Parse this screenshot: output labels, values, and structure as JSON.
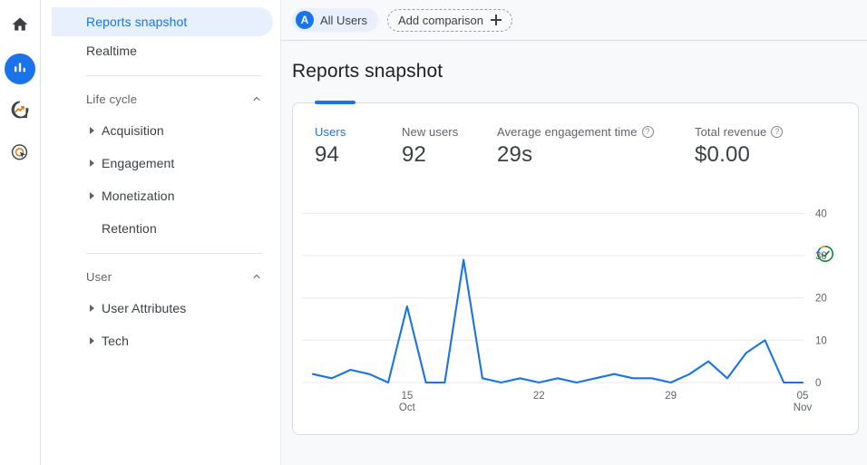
{
  "rail": {
    "items": [
      {
        "name": "home-icon",
        "label": "Home",
        "active": false
      },
      {
        "name": "reports-icon",
        "label": "Reports",
        "active": true
      },
      {
        "name": "explore-icon",
        "label": "Explore",
        "active": false
      },
      {
        "name": "advertising-icon",
        "label": "Advertising",
        "active": false
      }
    ]
  },
  "sidebar": {
    "top_items": [
      {
        "label": "Reports snapshot",
        "selected": true
      },
      {
        "label": "Realtime",
        "selected": false
      }
    ],
    "groups": [
      {
        "title": "Life cycle",
        "expanded": true,
        "items": [
          {
            "label": "Acquisition",
            "expandable": true
          },
          {
            "label": "Engagement",
            "expandable": true
          },
          {
            "label": "Monetization",
            "expandable": true
          },
          {
            "label": "Retention",
            "expandable": false
          }
        ]
      },
      {
        "title": "User",
        "expanded": true,
        "items": [
          {
            "label": "User Attributes",
            "expandable": true
          },
          {
            "label": "Tech",
            "expandable": true
          }
        ]
      }
    ]
  },
  "comparison_bar": {
    "all_users_chip": {
      "avatar_letter": "A",
      "label": "All Users"
    },
    "add_comparison": {
      "label": "Add comparison",
      "icon": "plus-icon"
    }
  },
  "page": {
    "title": "Reports snapshot"
  },
  "card": {
    "metrics": [
      {
        "label": "Users",
        "value": "94",
        "selected": true,
        "help": false
      },
      {
        "label": "New users",
        "value": "92",
        "selected": false,
        "help": false
      },
      {
        "label": "Average engagement time",
        "value": "29s",
        "selected": false,
        "help": true
      },
      {
        "label": "Total revenue",
        "value": "$0.00",
        "selected": false,
        "help": true
      }
    ],
    "insight_badge": {
      "icon": "check-circle-icon",
      "label": "Insights"
    }
  },
  "colors": {
    "accent_blue": "#1a73e8",
    "line_blue": "#1a73e8",
    "chip_bg": "#e8f0fe",
    "text_primary": "#202124",
    "text_secondary": "#5f6368",
    "grid": "#e8eaed",
    "card_border": "#dadce0",
    "page_bg": "#f8f9fa",
    "badge_green": "#188038",
    "badge_yellow": "#f9ab00",
    "badge_blue": "#1a73e8"
  },
  "chart_data": {
    "type": "line",
    "title": "",
    "xlabel": "",
    "ylabel": "",
    "ylim": [
      0,
      42
    ],
    "yticks": [
      0,
      10,
      20,
      30,
      40
    ],
    "ytick_labels": [
      "0",
      "10",
      "20",
      "30",
      "40"
    ],
    "grid": true,
    "legend": null,
    "xtick_labels": [
      {
        "primary": "15",
        "secondary": "Oct",
        "index": 5
      },
      {
        "primary": "22",
        "secondary": "",
        "index": 12
      },
      {
        "primary": "29",
        "secondary": "",
        "index": 19
      },
      {
        "primary": "05",
        "secondary": "Nov",
        "index": 26
      }
    ],
    "series": [
      {
        "name": "Users",
        "color": "#1a73e8",
        "values": [
          2,
          1,
          3,
          2,
          0,
          18,
          0,
          0,
          29,
          1,
          0,
          1,
          0,
          1,
          0,
          1,
          2,
          1,
          1,
          0,
          2,
          5,
          1,
          7,
          10,
          0,
          0
        ]
      }
    ]
  }
}
